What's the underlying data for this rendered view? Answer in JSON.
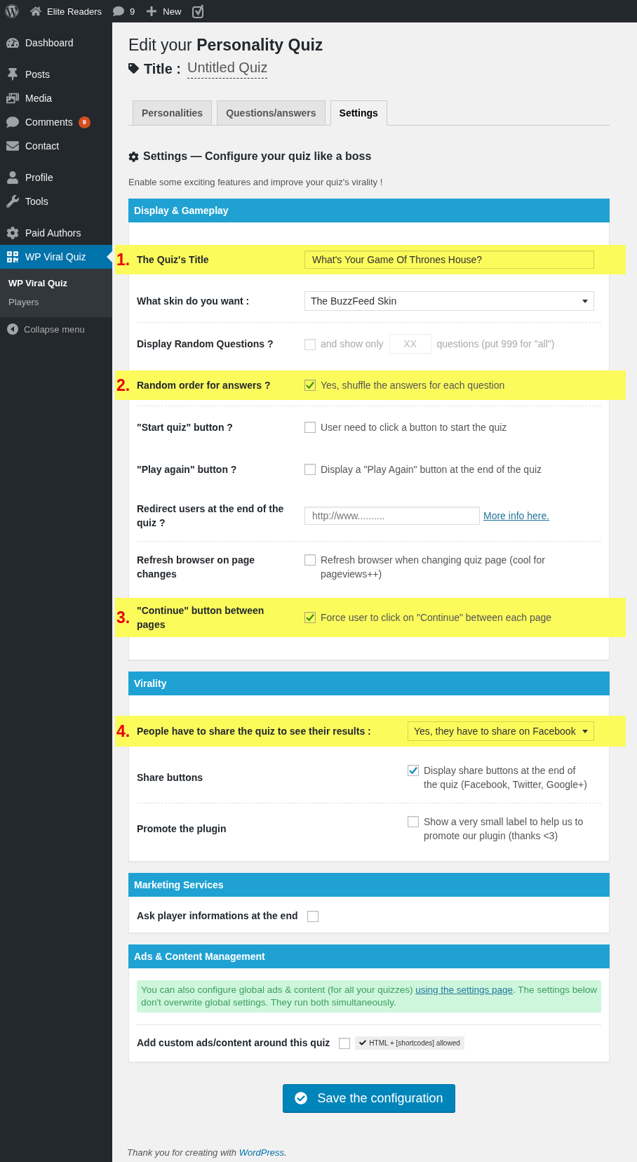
{
  "admin_bar": {
    "site_name": "Elite Readers",
    "comment_count": "9",
    "new_label": "New"
  },
  "sidebar": {
    "groups": [
      {
        "items": [
          {
            "label": "Dashboard",
            "selected": false
          }
        ]
      },
      {
        "items": [
          {
            "label": "Posts",
            "selected": false
          },
          {
            "label": "Media",
            "selected": false
          },
          {
            "label": "Comments",
            "selected": false,
            "badge": "9"
          },
          {
            "label": "Contact",
            "selected": false
          }
        ]
      },
      {
        "items": [
          {
            "label": "Profile",
            "selected": false
          },
          {
            "label": "Tools",
            "selected": false
          }
        ]
      },
      {
        "items": [
          {
            "label": "Paid Authors",
            "selected": false
          },
          {
            "label": "WP Viral Quiz",
            "selected": true,
            "submenu": [
              {
                "label": "WP Viral Quiz",
                "selected": true
              },
              {
                "label": "Players",
                "selected": false
              }
            ]
          }
        ]
      }
    ],
    "collapse_label": "Collapse menu"
  },
  "page": {
    "heading": "Edit your **Personality Quiz**",
    "title_label": "Title :",
    "title_value": "Untitled Quiz"
  },
  "tabs": [
    {
      "label": "Personalities",
      "selected": false
    },
    {
      "label": "Questions/answers",
      "selected": false
    },
    {
      "label": "Settings",
      "selected": true
    }
  ],
  "settings": {
    "heading": "Settings — Configure your quiz like a boss",
    "description": "Enable some exciting features and improve your quiz's virality !"
  },
  "sections": [
    {
      "title": "Display & Gameplay",
      "rows": [
        {
          "kind": "text",
          "label": "The Quiz's Title",
          "value": "What's Your Game Of Thrones House?",
          "highlighted": true,
          "marker": "1.",
          "divider_below": false,
          "disabled": false
        },
        {
          "kind": "select",
          "label": "What skin do you want :",
          "value": "The BuzzFeed Skin",
          "highlighted": false,
          "divider_below": true,
          "disabled": false
        },
        {
          "kind": "count",
          "label": "Display Random Questions ?",
          "checked": false,
          "text": "and show only",
          "placeholder": "XX",
          "suffix": "questions (put 999 for \"all\")",
          "highlighted": false,
          "divider_below": false,
          "disabled": true
        },
        {
          "kind": "checkbox",
          "label": "Random order for answers ?",
          "checked": true,
          "text": "Yes, shuffle the answers for each question",
          "highlighted": true,
          "marker": "2.",
          "divider_below": true,
          "disabled": false
        },
        {
          "kind": "checkbox",
          "label": "\"Start quiz\" button ?",
          "checked": false,
          "text": "User need to click a button to start the quiz",
          "highlighted": false,
          "divider_below": false,
          "disabled": false
        },
        {
          "kind": "checkbox",
          "label": "\"Play again\" button ?",
          "checked": false,
          "text": "Display a \"Play Again\" button at the end of the quiz",
          "highlighted": false,
          "divider_below": false,
          "disabled": false
        },
        {
          "kind": "url",
          "label": "Redirect users at the end of the quiz ?",
          "placeholder": "http://www..........",
          "link": "More info here.",
          "highlighted": false,
          "divider_below": true,
          "disabled": false
        },
        {
          "kind": "checkbox",
          "label": "Refresh browser on page changes",
          "checked": false,
          "text": "Refresh browser when changing quiz page (cool for pageviews++)",
          "highlighted": false,
          "divider_below": false,
          "disabled": false
        },
        {
          "kind": "checkbox",
          "label": "\"Continue\" button between pages",
          "checked": true,
          "text": "Force user to click on \"Continue\" between each page",
          "highlighted": true,
          "marker": "3.",
          "divider_below": false,
          "disabled": false
        }
      ]
    },
    {
      "title": "Virality",
      "rows": [
        {
          "kind": "select",
          "label": "People have to share the quiz to see their results :",
          "value": "Yes, they have to share on Facebook",
          "highlighted": true,
          "marker": "4.",
          "divider_below": false,
          "disabled": false
        },
        {
          "kind": "checkbox",
          "label": "Share buttons",
          "checked": true,
          "text": "Display share buttons at the end of the quiz (Facebook, Twitter, Google+)",
          "highlighted": false,
          "divider_below": true,
          "disabled": false
        },
        {
          "kind": "checkbox",
          "label": "Promote the plugin",
          "checked": false,
          "text": "Show a very small label to help us to promote our plugin (thanks <3)",
          "highlighted": false,
          "divider_below": false,
          "disabled": false
        }
      ]
    },
    {
      "title": "Marketing Services",
      "rows": [
        {
          "kind": "inline_checkbox",
          "label": "Ask player informations at the end",
          "checked": false,
          "highlighted": false,
          "divider_below": false,
          "disabled": false
        }
      ]
    },
    {
      "title": "Ads & Content Management",
      "notice": {
        "text": "You can also configure global ads & content (for all your quizzes)",
        "link": "using the settings page",
        "text_after": ". The settings below don't overwrite global settings. They run both simultaneously."
      },
      "rows": [
        {
          "kind": "inline_checkbox",
          "label": "Add custom ads/content around this quiz",
          "checked": false,
          "tag": "HTML + [shortcodes] allowed",
          "highlighted": false,
          "divider_below": false,
          "disabled": false
        }
      ]
    }
  ],
  "save_button": "Save the configuration",
  "footer": {
    "text": "Thank you for creating with",
    "link": "WordPress",
    "text_after": "."
  }
}
